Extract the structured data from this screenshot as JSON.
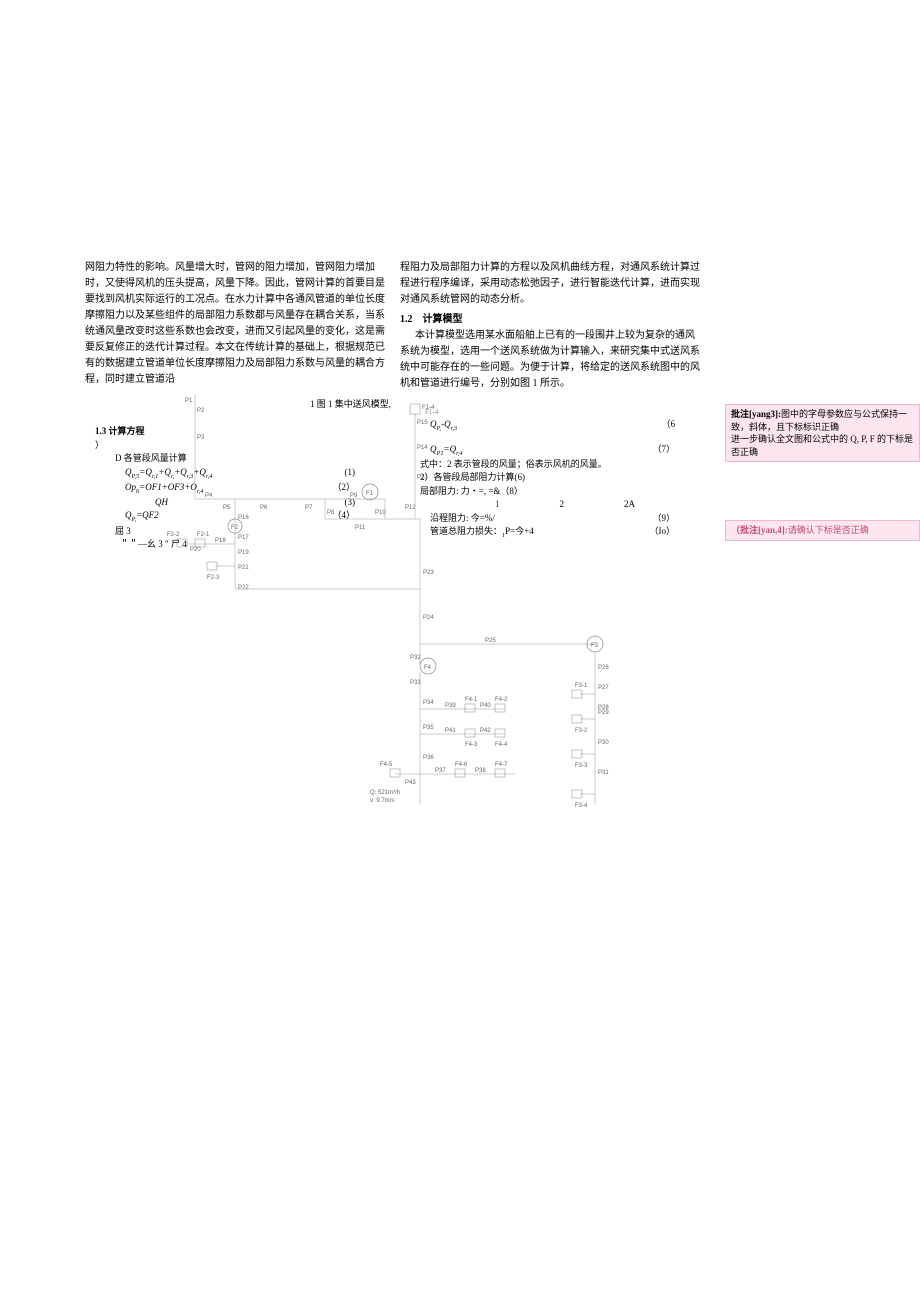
{
  "leftCol": {
    "para": "网阻力特性的影响。风量增大时，管网的阻力增加，管网阻力增加时，又使得风机的压头提高，风量下降。因此，管网计算的首要目是要找到风机实际运行的工况点。在水力计算中各通风管道的单位长度摩擦阻力以及某些组件的局部阻力系数都与风量存在耦合关系，当系统通风量改变时这些系数也会改变，进而又引起风量的变化，这是需要反复修正的迭代计算过程。本文在传统计算的基础上，根据规范已有的数据建立管道单位长度摩擦阻力及局部阻力系数与风量的耦合方程，同时建立管道沿"
  },
  "rightCol": {
    "para": "程阻力及局部阻力计算的方程以及风机曲线方程，对通风系统计算过程进行程序编译，采用动态松弛因子，进行智能迭代计算，进而实现对通风系统管网的动态分析。",
    "sec12": "1.2　计算模型",
    "body12": "本计算模型选用某水面船舶上已有的一段围井上较为复杂的通风系统为模型，选用一个送风系统做为计算输入，来研究集中式送风系统中可能存在的一些问题。为便于计算，将给定的送风系统图中的风机和管道进行编号，分别如图 1 所示。"
  },
  "figCaption": "1 图 1 集中送风模型,",
  "eqLeft": {
    "title": "1.3 计算方程",
    "sub": "）",
    "d": "D 各管段风量计算",
    "r1l": "Q",
    "r1s": "P,5",
    "r1m": "=Q",
    "r1s2": "r,1",
    "r1p": "+Q",
    "r1s3": "r,",
    "r1p2": "+Q",
    "r1s4": "r,3",
    "r1p3": "+Q",
    "r1s5": "r,4",
    "r1n": "(1)",
    "r2l": "Op",
    "r2s": "6",
    "r2m": "=OF1+OF3+O",
    "r2s2": "r,4",
    "r2n": "（2）",
    "r3l": "QH",
    "r3n": "(3)",
    "r4l": "Q",
    "r4s": "P,",
    "r4m": "=QF2",
    "r4n": "（4）",
    "r5a": "屈 3",
    "r5b": "＂＂—幺 3 ″ 尸 4"
  },
  "eqRight": {
    "r0": "F1-4",
    "r1l": "Q",
    "r1s": "P,",
    "r1m": "-Q",
    "r1s2": "r,3",
    "r1n": "（6",
    "r2l": "Q",
    "r2s": "P1",
    "r2m": "=Q",
    "r2s2": "r,4",
    "r2n": "（7）",
    "r3": "式中：2 表示管段的风量；俗表示风机的风量。",
    "r4": "2）各管段局部阻力计算(6)",
    "r5l": "局部阻力: 力・=, =&（8）",
    "r6a": "1",
    "r6b": "2",
    "r6c": "2A",
    "r7l": "沿程阻力: 今=%/",
    "r7n": "（9）",
    "r8l": "管道总阻力损失：",
    "r8m": "1",
    "r8p": "P=今+4",
    "r8n": "（Io）"
  },
  "diagram": {
    "nodes": [
      "P1",
      "P2",
      "P3",
      "P4",
      "P5",
      "P6",
      "P7",
      "P8",
      "P9",
      "P10",
      "P11",
      "P12",
      "P13",
      "P14",
      "P15",
      "P16",
      "P17",
      "P18",
      "P19",
      "P20",
      "P21",
      "P22",
      "P23",
      "P24",
      "P25",
      "P26",
      "P27",
      "P28",
      "P29",
      "P30",
      "P31",
      "P32",
      "P33",
      "P34",
      "P35",
      "P36",
      "P37",
      "P38",
      "P39",
      "P40",
      "P41",
      "P42",
      "P43"
    ],
    "fans": [
      "F1",
      "F2",
      "F3",
      "F4"
    ],
    "terminals": [
      "F1-4",
      "F2-1",
      "F2-2",
      "F2-3",
      "F3-1",
      "F3-2",
      "F3-3",
      "F3-4",
      "F4-1",
      "F4-2",
      "F4-3",
      "F4-4",
      "F4-5",
      "F4-6",
      "F4-7"
    ],
    "annot1": "Q:  521m³/h",
    "annot2": "v:   9.7m/s"
  },
  "comments": {
    "c1tag": "批注[yang3]:",
    "c1body": "图中的字母参数应与公式保持一致，斜体，且下标标识正确",
    "c1body2": "进一步确认全文图和公式中的 Q, P, F 的下标是否正确",
    "c2tag": "（批注[yan,4]:",
    "c2body": "请确认下标是否正确"
  }
}
